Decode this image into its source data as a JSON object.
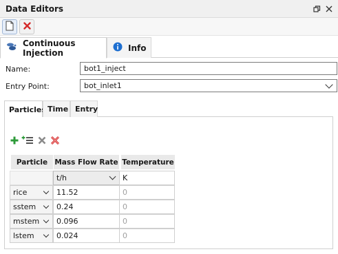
{
  "window": {
    "title": "Data Editors"
  },
  "tabs": {
    "main": [
      {
        "label": "Continuous Injection",
        "active": true
      },
      {
        "label": "Info",
        "active": false
      }
    ],
    "sub": [
      {
        "label": "Particles",
        "active": true
      },
      {
        "label": "Time",
        "active": false
      },
      {
        "label": "Entry",
        "active": false
      }
    ]
  },
  "form": {
    "name_label": "Name:",
    "name_value": "bot1_inject",
    "entry_label": "Entry Point:",
    "entry_value": "bot_inlet1"
  },
  "table": {
    "headers": [
      "Particle",
      "Mass Flow Rate",
      "Temperature"
    ],
    "units": {
      "mass_flow": "t/h",
      "temperature": "K"
    },
    "rows": [
      {
        "particle": "rice",
        "flow": "11.52",
        "temp": "0"
      },
      {
        "particle": "sstem",
        "flow": "0.24",
        "temp": "0"
      },
      {
        "particle": "mstem",
        "flow": "0.096",
        "temp": "0"
      },
      {
        "particle": "lstem",
        "flow": "0.024",
        "temp": "0"
      }
    ]
  },
  "colors": {
    "accent": "#1e6fd0",
    "delete_red": "#d42a2a",
    "add_green": "#2e9b3a"
  },
  "icons": {
    "new": "document-icon",
    "delete": "close-red-icon",
    "restore": "restore-window-icon",
    "close": "close-icon",
    "injection": "injection-icon",
    "info": "info-icon",
    "add": "add-icon",
    "add_list": "add-list-icon",
    "remove": "remove-icon",
    "remove_all": "remove-all-icon"
  }
}
